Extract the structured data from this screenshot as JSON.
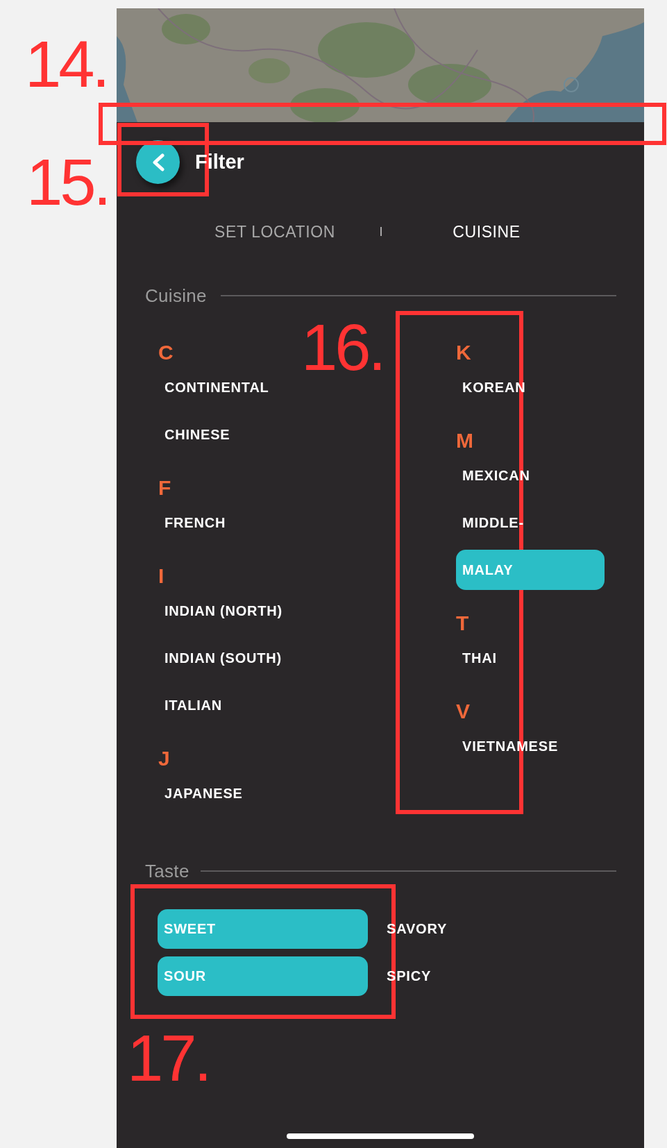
{
  "header": {
    "title": "Filter"
  },
  "tabs": [
    {
      "label": "SET LOCATION",
      "selected": false
    },
    {
      "label": "CUISINE",
      "selected": true
    }
  ],
  "tab_separator": "I",
  "cuisine": {
    "title": "Cuisine",
    "columns": [
      [
        {
          "kind": "letter",
          "text": "C"
        },
        {
          "kind": "option",
          "label": "CONTINENTAL",
          "selected": false
        },
        {
          "kind": "option",
          "label": "CHINESE",
          "selected": false
        },
        {
          "kind": "letter",
          "text": "F"
        },
        {
          "kind": "option",
          "label": "FRENCH",
          "selected": false
        },
        {
          "kind": "letter",
          "text": "I"
        },
        {
          "kind": "option",
          "label": "INDIAN (NORTH)",
          "selected": false
        },
        {
          "kind": "option",
          "label": "INDIAN (SOUTH)",
          "selected": false
        },
        {
          "kind": "option",
          "label": "ITALIAN",
          "selected": false
        },
        {
          "kind": "letter",
          "text": "J"
        },
        {
          "kind": "option",
          "label": "JAPANESE",
          "selected": false
        }
      ],
      [
        {
          "kind": "letter",
          "text": "K"
        },
        {
          "kind": "option",
          "label": "KOREAN",
          "selected": false
        },
        {
          "kind": "letter",
          "text": "M"
        },
        {
          "kind": "option",
          "label": "MEXICAN",
          "selected": false
        },
        {
          "kind": "option",
          "label": "MIDDLE-",
          "selected": false
        },
        {
          "kind": "option",
          "label": "MALAY",
          "selected": true
        },
        {
          "kind": "letter",
          "text": "T"
        },
        {
          "kind": "option",
          "label": "THAI",
          "selected": false
        },
        {
          "kind": "letter",
          "text": "V"
        },
        {
          "kind": "option",
          "label": "VIETNAMESE",
          "selected": false
        }
      ]
    ]
  },
  "taste": {
    "title": "Taste",
    "options": [
      {
        "label": "SWEET",
        "selected": true
      },
      {
        "label": "SAVORY",
        "selected": false
      },
      {
        "label": "SOUR",
        "selected": true
      },
      {
        "label": "SPICY",
        "selected": false
      }
    ]
  },
  "annotations": [
    {
      "label": "14."
    },
    {
      "label": "15."
    },
    {
      "label": "16."
    },
    {
      "label": "17."
    }
  ]
}
